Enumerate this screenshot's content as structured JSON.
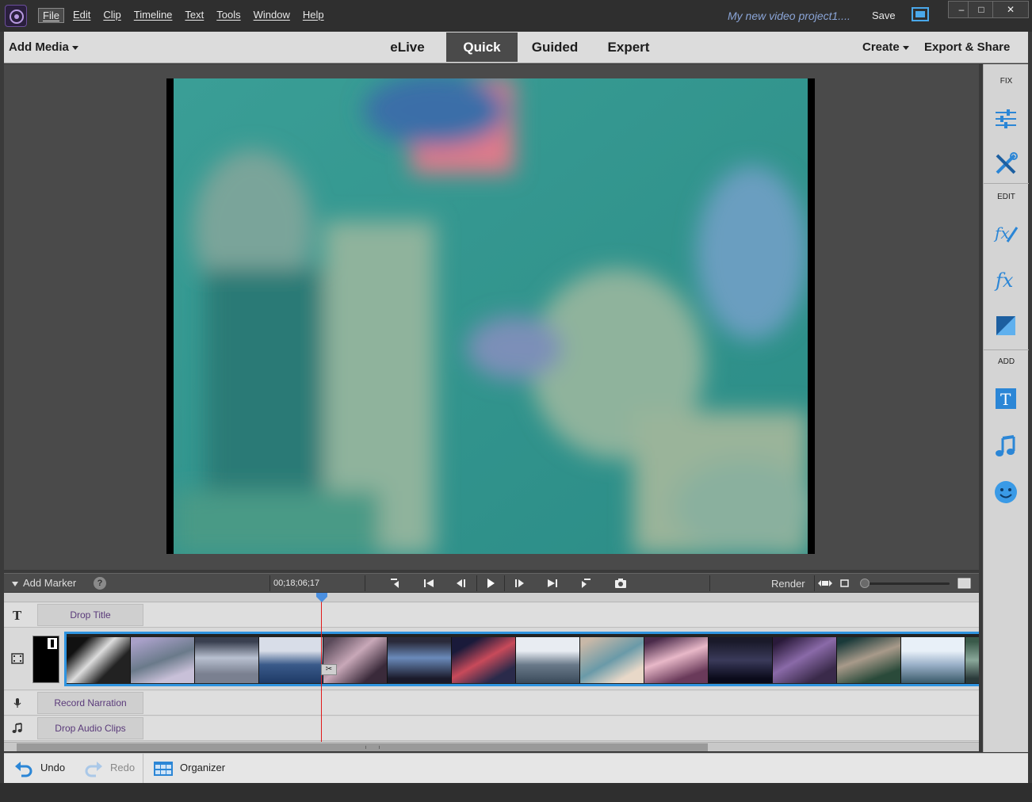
{
  "menu": {
    "items": [
      "File",
      "Edit",
      "Clip",
      "Timeline",
      "Text",
      "Tools",
      "Window",
      "Help"
    ]
  },
  "titlebar": {
    "project_name": "My new video project1....",
    "save_label": "Save",
    "window_buttons": [
      "minimize-icon",
      "maximize-icon",
      "close-icon"
    ]
  },
  "modebar": {
    "add_media_label": "Add Media",
    "tabs": [
      {
        "label": "eLive",
        "active": false
      },
      {
        "label": "Quick",
        "active": true
      },
      {
        "label": "Guided",
        "active": false
      },
      {
        "label": "Expert",
        "active": false
      }
    ],
    "create_label": "Create",
    "export_label": "Export & Share"
  },
  "right_panel": {
    "fix_label": "FIX",
    "edit_label": "EDIT",
    "add_label": "ADD",
    "icons": [
      "adjustments-icon",
      "tools-icon",
      "applied-effects-icon",
      "effects-icon",
      "transitions-icon",
      "titles-icon",
      "music-icon",
      "graphics-icon"
    ]
  },
  "timeline_toolbar": {
    "add_marker_label": "Add Marker",
    "help_label": "?",
    "timecode": "00;18;06;17",
    "render_label": "Render",
    "controls": [
      "goto-start-icon",
      "previous-edit-icon",
      "step-back-icon",
      "play-icon",
      "step-forward-icon",
      "next-edit-icon",
      "goto-end-icon",
      "snapshot-icon"
    ]
  },
  "tracks": {
    "title_label": "Drop Title",
    "narration_label": "Record Narration",
    "audio_label": "Drop Audio Clips"
  },
  "bottombar": {
    "undo_label": "Undo",
    "redo_label": "Redo",
    "organizer_label": "Organizer"
  },
  "colors": {
    "accent": "#2f94e0",
    "playhead": "#e01b1b",
    "drop_text": "#5a3a7a"
  }
}
